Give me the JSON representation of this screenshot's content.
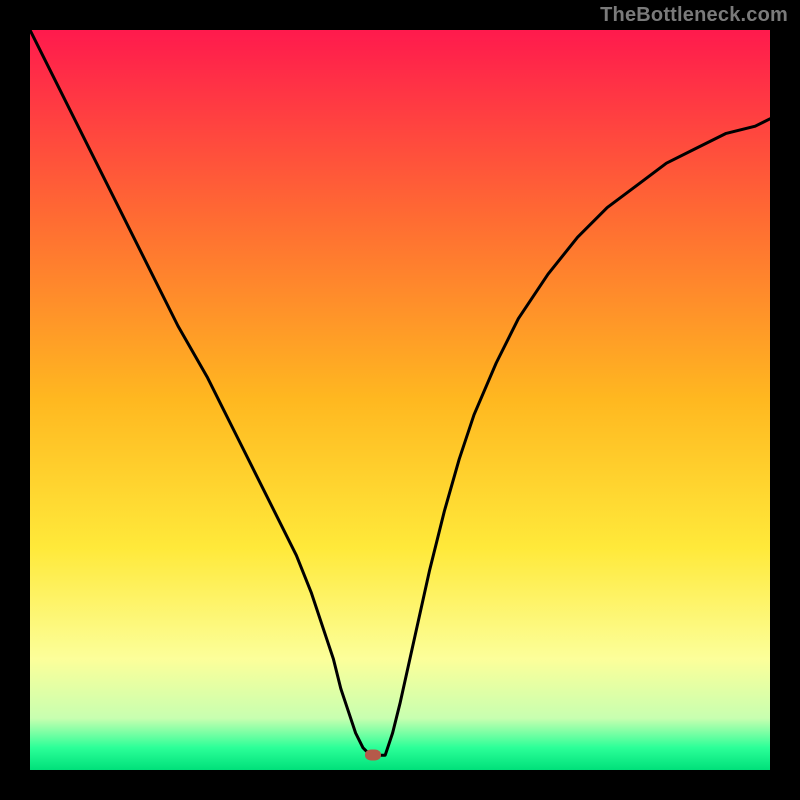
{
  "watermark": "TheBottleneck.com",
  "chart_data": {
    "type": "line",
    "title": "",
    "xlabel": "",
    "ylabel": "",
    "xlim": [
      0,
      100
    ],
    "ylim": [
      0,
      100
    ],
    "background": {
      "type": "vertical-gradient",
      "stops": [
        {
          "pos": 0,
          "color": "#ff1a4d"
        },
        {
          "pos": 25,
          "color": "#ff6a33"
        },
        {
          "pos": 50,
          "color": "#ffb820"
        },
        {
          "pos": 70,
          "color": "#ffe93a"
        },
        {
          "pos": 85,
          "color": "#fcff9a"
        },
        {
          "pos": 93,
          "color": "#c8ffb0"
        },
        {
          "pos": 97,
          "color": "#2bff98"
        },
        {
          "pos": 100,
          "color": "#00e07a"
        }
      ]
    },
    "series": [
      {
        "name": "curve",
        "color": "#000000",
        "width": 2,
        "x": [
          0,
          4,
          8,
          12,
          16,
          20,
          24,
          26,
          28,
          30,
          32,
          34,
          36,
          38,
          40,
          41,
          42,
          43,
          44,
          45,
          46,
          47,
          48,
          49,
          50,
          52,
          54,
          56,
          58,
          60,
          63,
          66,
          70,
          74,
          78,
          82,
          86,
          90,
          94,
          98,
          100
        ],
        "y": [
          100,
          92,
          84,
          76,
          68,
          60,
          53,
          49,
          45,
          41,
          37,
          33,
          29,
          24,
          18,
          15,
          11,
          8,
          5,
          3,
          2,
          2,
          2,
          5,
          9,
          18,
          27,
          35,
          42,
          48,
          55,
          61,
          67,
          72,
          76,
          79,
          82,
          84,
          86,
          87,
          88
        ]
      }
    ],
    "marker": {
      "x": 46.3,
      "y": 2
    }
  }
}
